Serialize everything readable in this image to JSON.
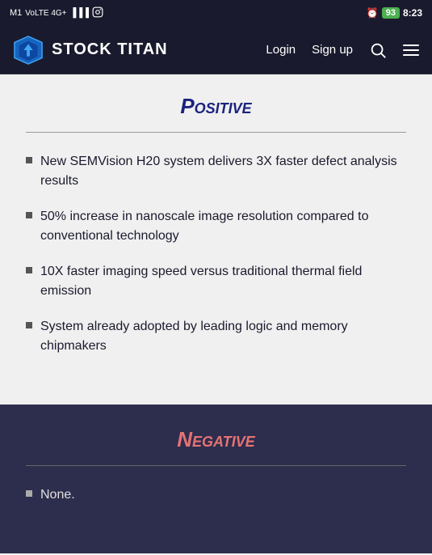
{
  "statusBar": {
    "carrier": "M1",
    "network": "VoLTE 4G+",
    "time": "8:23",
    "battery": "93"
  },
  "navbar": {
    "logoText": "STOCK TITAN",
    "loginLabel": "Login",
    "signupLabel": "Sign up"
  },
  "positive": {
    "title": "Positive",
    "items": [
      "New SEMVision H20 system delivers 3X faster defect analysis results",
      "50% increase in nanoscale image resolution compared to conventional technology",
      "10X faster imaging speed versus traditional thermal field emission",
      "System already adopted by leading logic and memory chipmakers"
    ]
  },
  "negative": {
    "title": "Negative",
    "items": [
      "None."
    ]
  }
}
